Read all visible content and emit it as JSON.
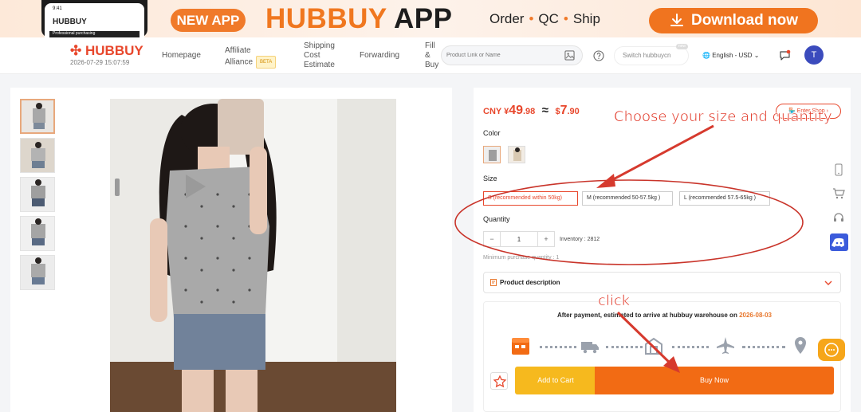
{
  "banner": {
    "phone_time": "9:41",
    "phone_logo": "HUBBUY",
    "phone_tag": "Professional purchasing",
    "new_app": "NEW APP",
    "title_orange": "HUBBUY",
    "title_dark": "APP",
    "features": [
      "Order",
      "QC",
      "Ship"
    ],
    "download": "Download now"
  },
  "nav": {
    "brand": "HUBBUY",
    "datetime": "2026-07-29 15:07:59",
    "items": {
      "homepage": "Homepage",
      "affiliate_1": "Affiliate",
      "affiliate_2": "Alliance",
      "beta": "BETA",
      "shipping_1": "Shipping",
      "shipping_2": "Cost",
      "shipping_3": "Estimate",
      "forwarding": "Forwarding",
      "fill_1": "Fill",
      "fill_2": "&",
      "fill_3": "Buy"
    },
    "search_placeholder": "Product Link or Name",
    "switch_label": "Switch hubbuycn",
    "switch_badge": "new",
    "language": "English - USD",
    "avatar_letter": "T"
  },
  "product": {
    "price_cny_label": "CNY ¥",
    "price_cny_int": "49",
    "price_cny_dec": ".98",
    "approx": "≈",
    "price_usd_sym": "$",
    "price_usd_int": "7",
    "price_usd_dec": ".90",
    "enter_shop": "Enter Shop",
    "color_label": "Color",
    "size_label": "Size",
    "sizes": [
      "S (recommended within 50kg)",
      "M (recommended 50-57.5kg )",
      "L (recommended 57.5-65kg )"
    ],
    "quantity_label": "Quantity",
    "quantity_value": "1",
    "inventory": "Inventory : 2812",
    "min_purchase": "Minimum purchase quantity : 1",
    "description_label": "Product description",
    "shipping_note": "After payment, estimated to arrive at hubbuy warehouse on",
    "shipping_date": "2026-08-03",
    "add_to_cart": "Add to Cart",
    "buy_now": "Buy Now"
  },
  "annotations": {
    "choose": "Choose your size and quantity",
    "click": "click",
    "color": "#e23a2a"
  },
  "colors": {
    "brand_orange": "#f0771f",
    "price_red": "#e8472c",
    "cart_yellow": "#f6b91e",
    "buy_orange": "#f26b14"
  }
}
